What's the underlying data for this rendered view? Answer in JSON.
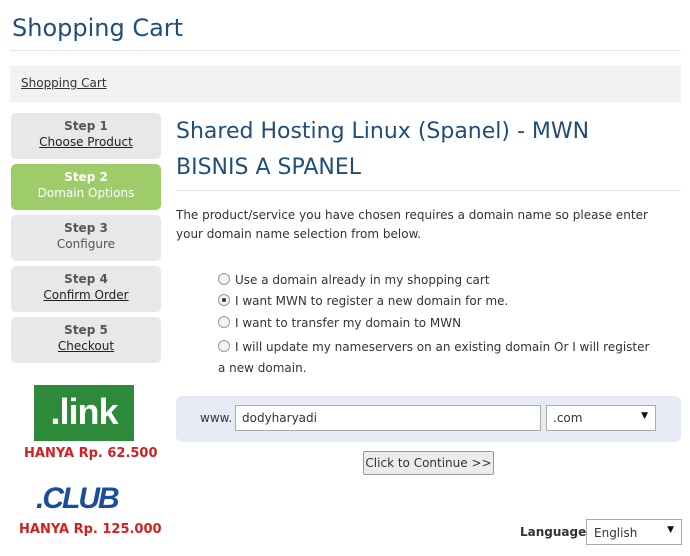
{
  "page": {
    "title": "Shopping Cart"
  },
  "breadcrumb": {
    "label": "Shopping Cart"
  },
  "steps": [
    {
      "num": "Step 1",
      "label": "Choose Product"
    },
    {
      "num": "Step 2",
      "label": "Domain Options"
    },
    {
      "num": "Step 3",
      "label": "Configure"
    },
    {
      "num": "Step 4",
      "label": "Confirm Order"
    },
    {
      "num": "Step 5",
      "label": "Checkout"
    }
  ],
  "promos": [
    {
      "logo": ".link",
      "price": "HANYA Rp. 62.500"
    },
    {
      "logo": ".CLUB",
      "price": "HANYA Rp. 125.000"
    }
  ],
  "product": {
    "title": "Shared Hosting Linux (Spanel) - MWN BISNIS A SPANEL",
    "intro": "The product/service you have chosen requires a domain name so please enter your domain name selection from below."
  },
  "domain_options": [
    {
      "label": "Use a domain already in my shopping cart",
      "selected": false
    },
    {
      "label": "I want MWN to register a new domain for me.",
      "selected": true
    },
    {
      "label": "I want to transfer my domain to MWN",
      "selected": false
    },
    {
      "label": "I will update my nameservers on an existing domain Or I will register a new domain.",
      "selected": false
    }
  ],
  "domain_form": {
    "prefix": "www.",
    "value": "dodyharyadi",
    "tld": ".com",
    "continue_label": "Click to Continue >>"
  },
  "language": {
    "label": "Language:",
    "value": "English"
  },
  "colors": {
    "title": "#1f4e79",
    "active_step": "#9fcc6b",
    "promo_price": "#d21f1f",
    "link_brand": "#2d8a3b",
    "club_brand": "#1a4e9c"
  }
}
